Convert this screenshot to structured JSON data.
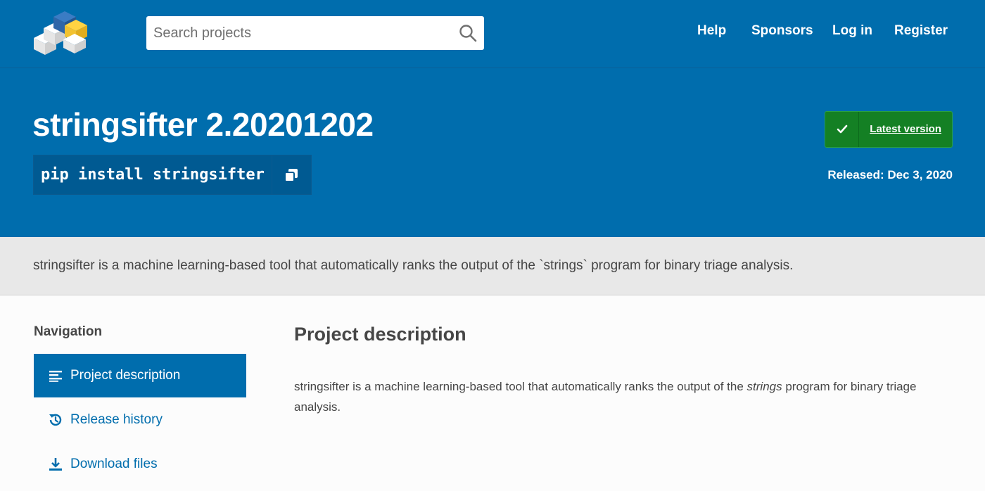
{
  "header": {
    "logo": "pypi-logo",
    "search": {
      "placeholder": "Search projects",
      "value": ""
    },
    "nav": [
      "Help",
      "Sponsors",
      "Log in",
      "Register"
    ]
  },
  "package": {
    "title": "stringsifter 2.20201202",
    "pip_command": "pip install stringsifter",
    "latest_label": "Latest version",
    "released": "Released: Dec 3, 2020"
  },
  "summary": "stringsifter is a machine learning-based tool that automatically ranks the output of the `strings` program for binary triage analysis.",
  "sidebar": {
    "heading": "Navigation",
    "items": [
      {
        "label": "Project description",
        "icon": "list-icon",
        "active": true
      },
      {
        "label": "Release history",
        "icon": "history-icon",
        "active": false
      },
      {
        "label": "Download files",
        "icon": "download-icon",
        "active": false
      }
    ]
  },
  "description": {
    "heading": "Project description",
    "text_before": "stringsifter is a machine learning-based tool that automatically ranks the output of the ",
    "text_em": "strings",
    "text_after": " program for binary triage analysis."
  },
  "colors": {
    "brand_blue": "#006dad",
    "latest_green": "#148024",
    "summary_bg": "#e8e8e8"
  }
}
